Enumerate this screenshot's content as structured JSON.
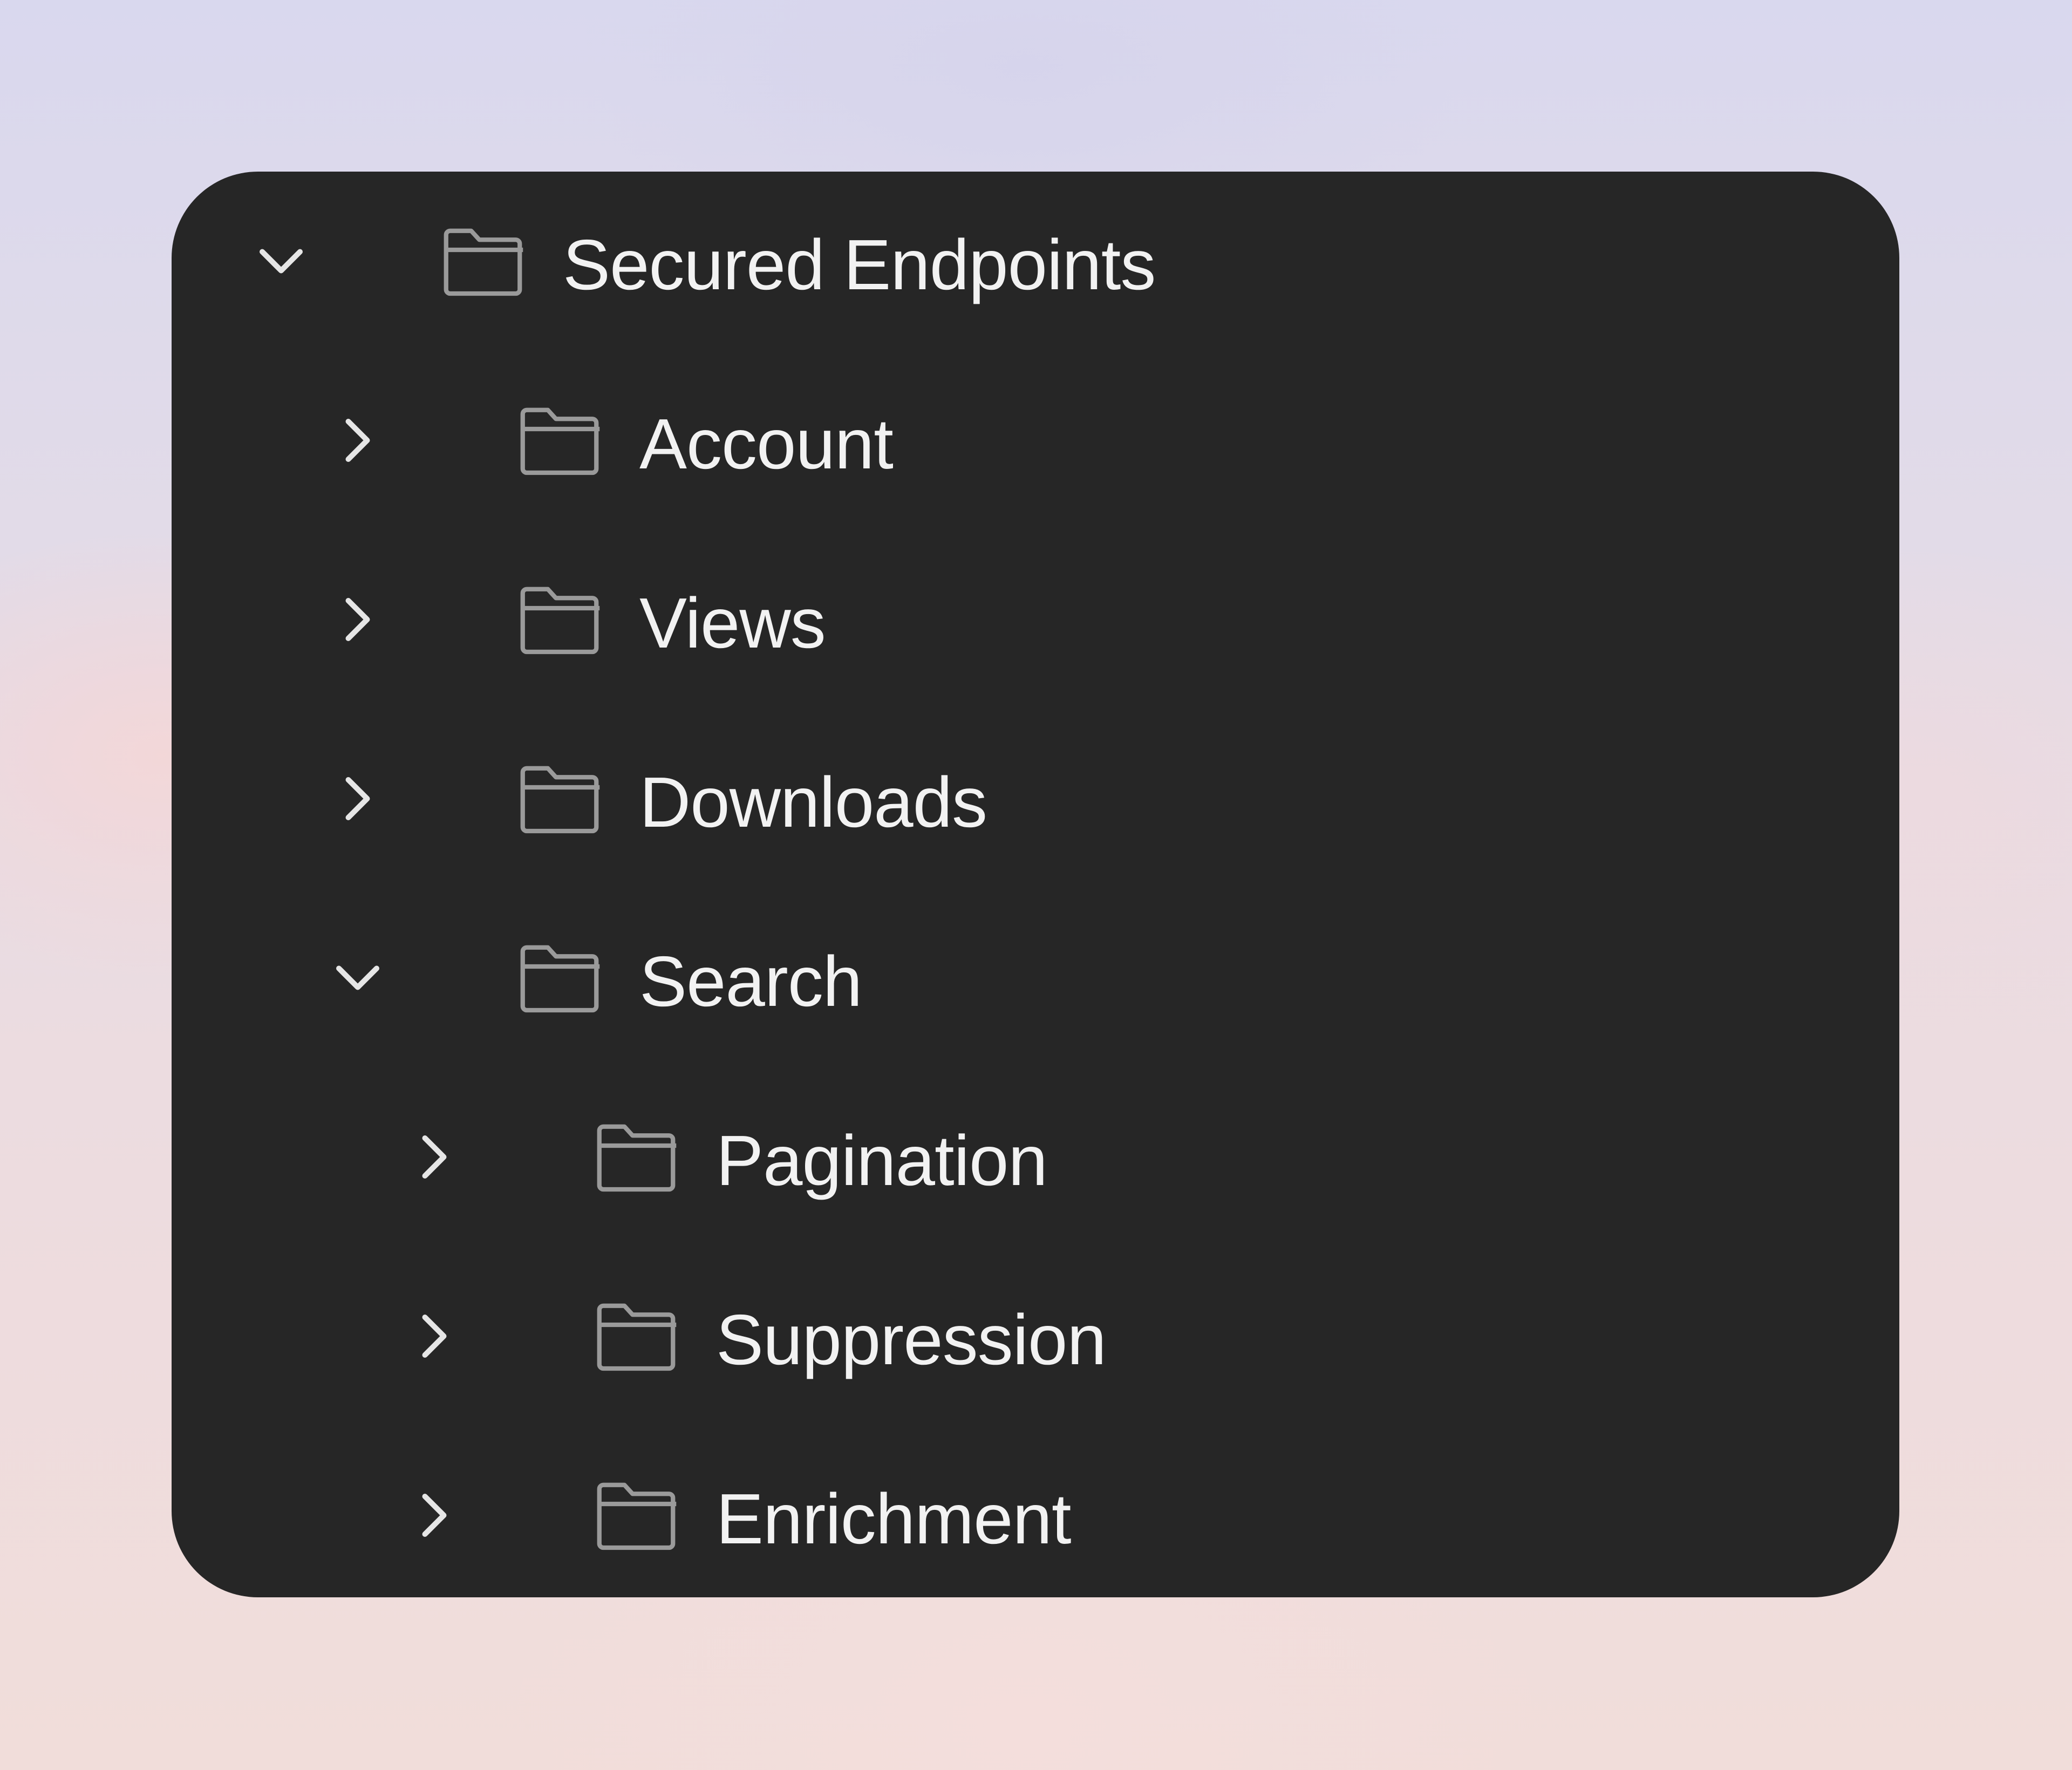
{
  "tree": {
    "items": [
      {
        "label": "Secured Endpoints",
        "depth": 0,
        "expanded": true,
        "icon": "folder-icon"
      },
      {
        "label": "Account",
        "depth": 1,
        "expanded": false,
        "icon": "folder-icon"
      },
      {
        "label": "Views",
        "depth": 1,
        "expanded": false,
        "icon": "folder-icon"
      },
      {
        "label": "Downloads",
        "depth": 1,
        "expanded": false,
        "icon": "folder-icon"
      },
      {
        "label": "Search",
        "depth": 1,
        "expanded": true,
        "icon": "folder-icon"
      },
      {
        "label": "Pagination",
        "depth": 2,
        "expanded": false,
        "icon": "folder-icon"
      },
      {
        "label": "Suppression",
        "depth": 2,
        "expanded": false,
        "icon": "folder-icon"
      },
      {
        "label": "Enrichment",
        "depth": 2,
        "expanded": false,
        "icon": "folder-icon"
      }
    ]
  },
  "colors": {
    "panel_background": "#262626",
    "text": "#f2f2f2",
    "icon_stroke": "#9a9a9a",
    "chevron": "#e6e6e6"
  }
}
